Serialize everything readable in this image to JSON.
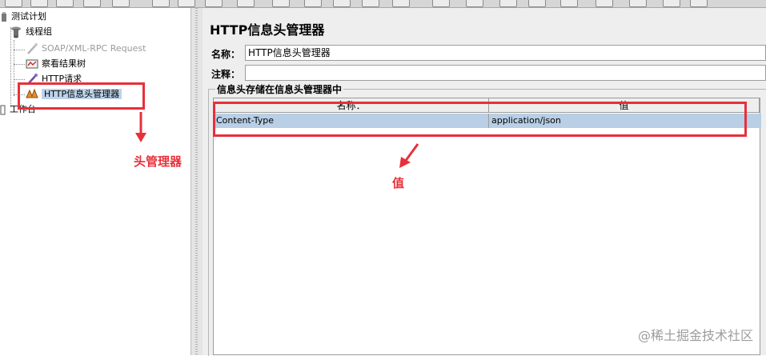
{
  "tree": {
    "root": "测试计划",
    "thread_group": "线程组",
    "items": [
      {
        "label": "SOAP/XML-RPC Request",
        "icon": "pipette-icon",
        "disabled": true
      },
      {
        "label": "察看结果树",
        "icon": "result-tree-icon",
        "disabled": false
      },
      {
        "label": "HTTP请求",
        "icon": "pipette-icon",
        "disabled": false
      },
      {
        "label": "HTTP信息头管理器",
        "icon": "header-manager-icon",
        "disabled": false,
        "selected": true
      }
    ],
    "workbench": "工作台"
  },
  "panel": {
    "title": "HTTP信息头管理器",
    "name_label": "名称：",
    "name_value": "HTTP信息头管理器",
    "comment_label": "注释：",
    "comment_value": "",
    "group_title": "信息头存储在信息头管理器中"
  },
  "table": {
    "columns": [
      "名称：",
      "值"
    ],
    "rows": [
      [
        "Content-Type",
        "application/json"
      ]
    ]
  },
  "annotations": {
    "header_manager": "头管理器",
    "value": "值",
    "color": "#e8303a"
  },
  "watermark": "@稀土掘金技术社区"
}
